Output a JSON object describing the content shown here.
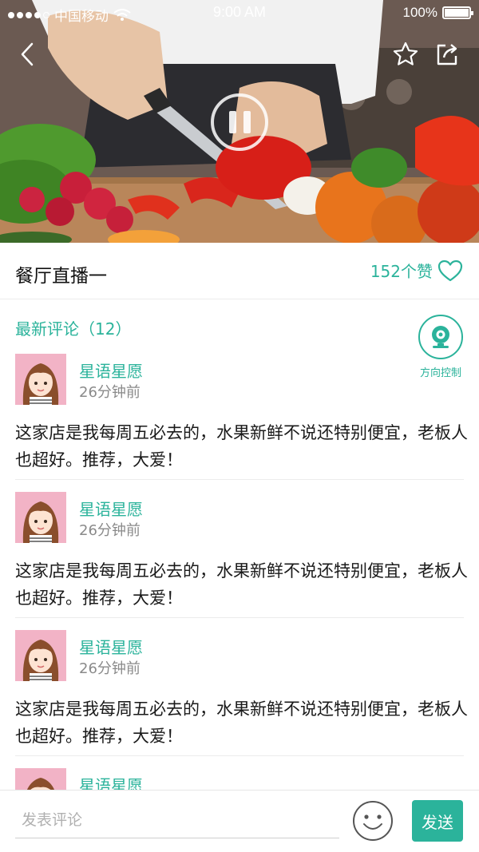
{
  "status_bar": {
    "carrier": "中国移动",
    "time": "9:00 AM",
    "battery": "100%"
  },
  "video": {
    "state": "playing",
    "icons": [
      "back-icon",
      "star-icon",
      "share-icon",
      "pause-icon"
    ]
  },
  "room": {
    "title": "餐厅直播一",
    "likes_label": "152个赞"
  },
  "comments_section": {
    "header_label": "最新评论",
    "count_label": "（12）",
    "direction_control_label": "方向控制"
  },
  "comments": [
    {
      "name": "星语星愿",
      "time": "26分钟前",
      "text": "这家店是我每周五必去的，水果新鲜不说还特别便宜，老板人也超好。推荐，大爱！"
    },
    {
      "name": "星语星愿",
      "time": "26分钟前",
      "text": "这家店是我每周五必去的，水果新鲜不说还特别便宜，老板人也超好。推荐，大爱！"
    },
    {
      "name": "星语星愿",
      "time": "26分钟前",
      "text": "这家店是我每周五必去的，水果新鲜不说还特别便宜，老板人也超好。推荐，大爱！"
    },
    {
      "name": "星语星愿",
      "time": "",
      "text": ""
    }
  ],
  "composer": {
    "placeholder": "发表评论",
    "value": "",
    "send_label": "发送"
  },
  "colors": {
    "accent": "#2bb39b",
    "secondary_text": "#8a8a8a",
    "divider": "#ececec"
  }
}
